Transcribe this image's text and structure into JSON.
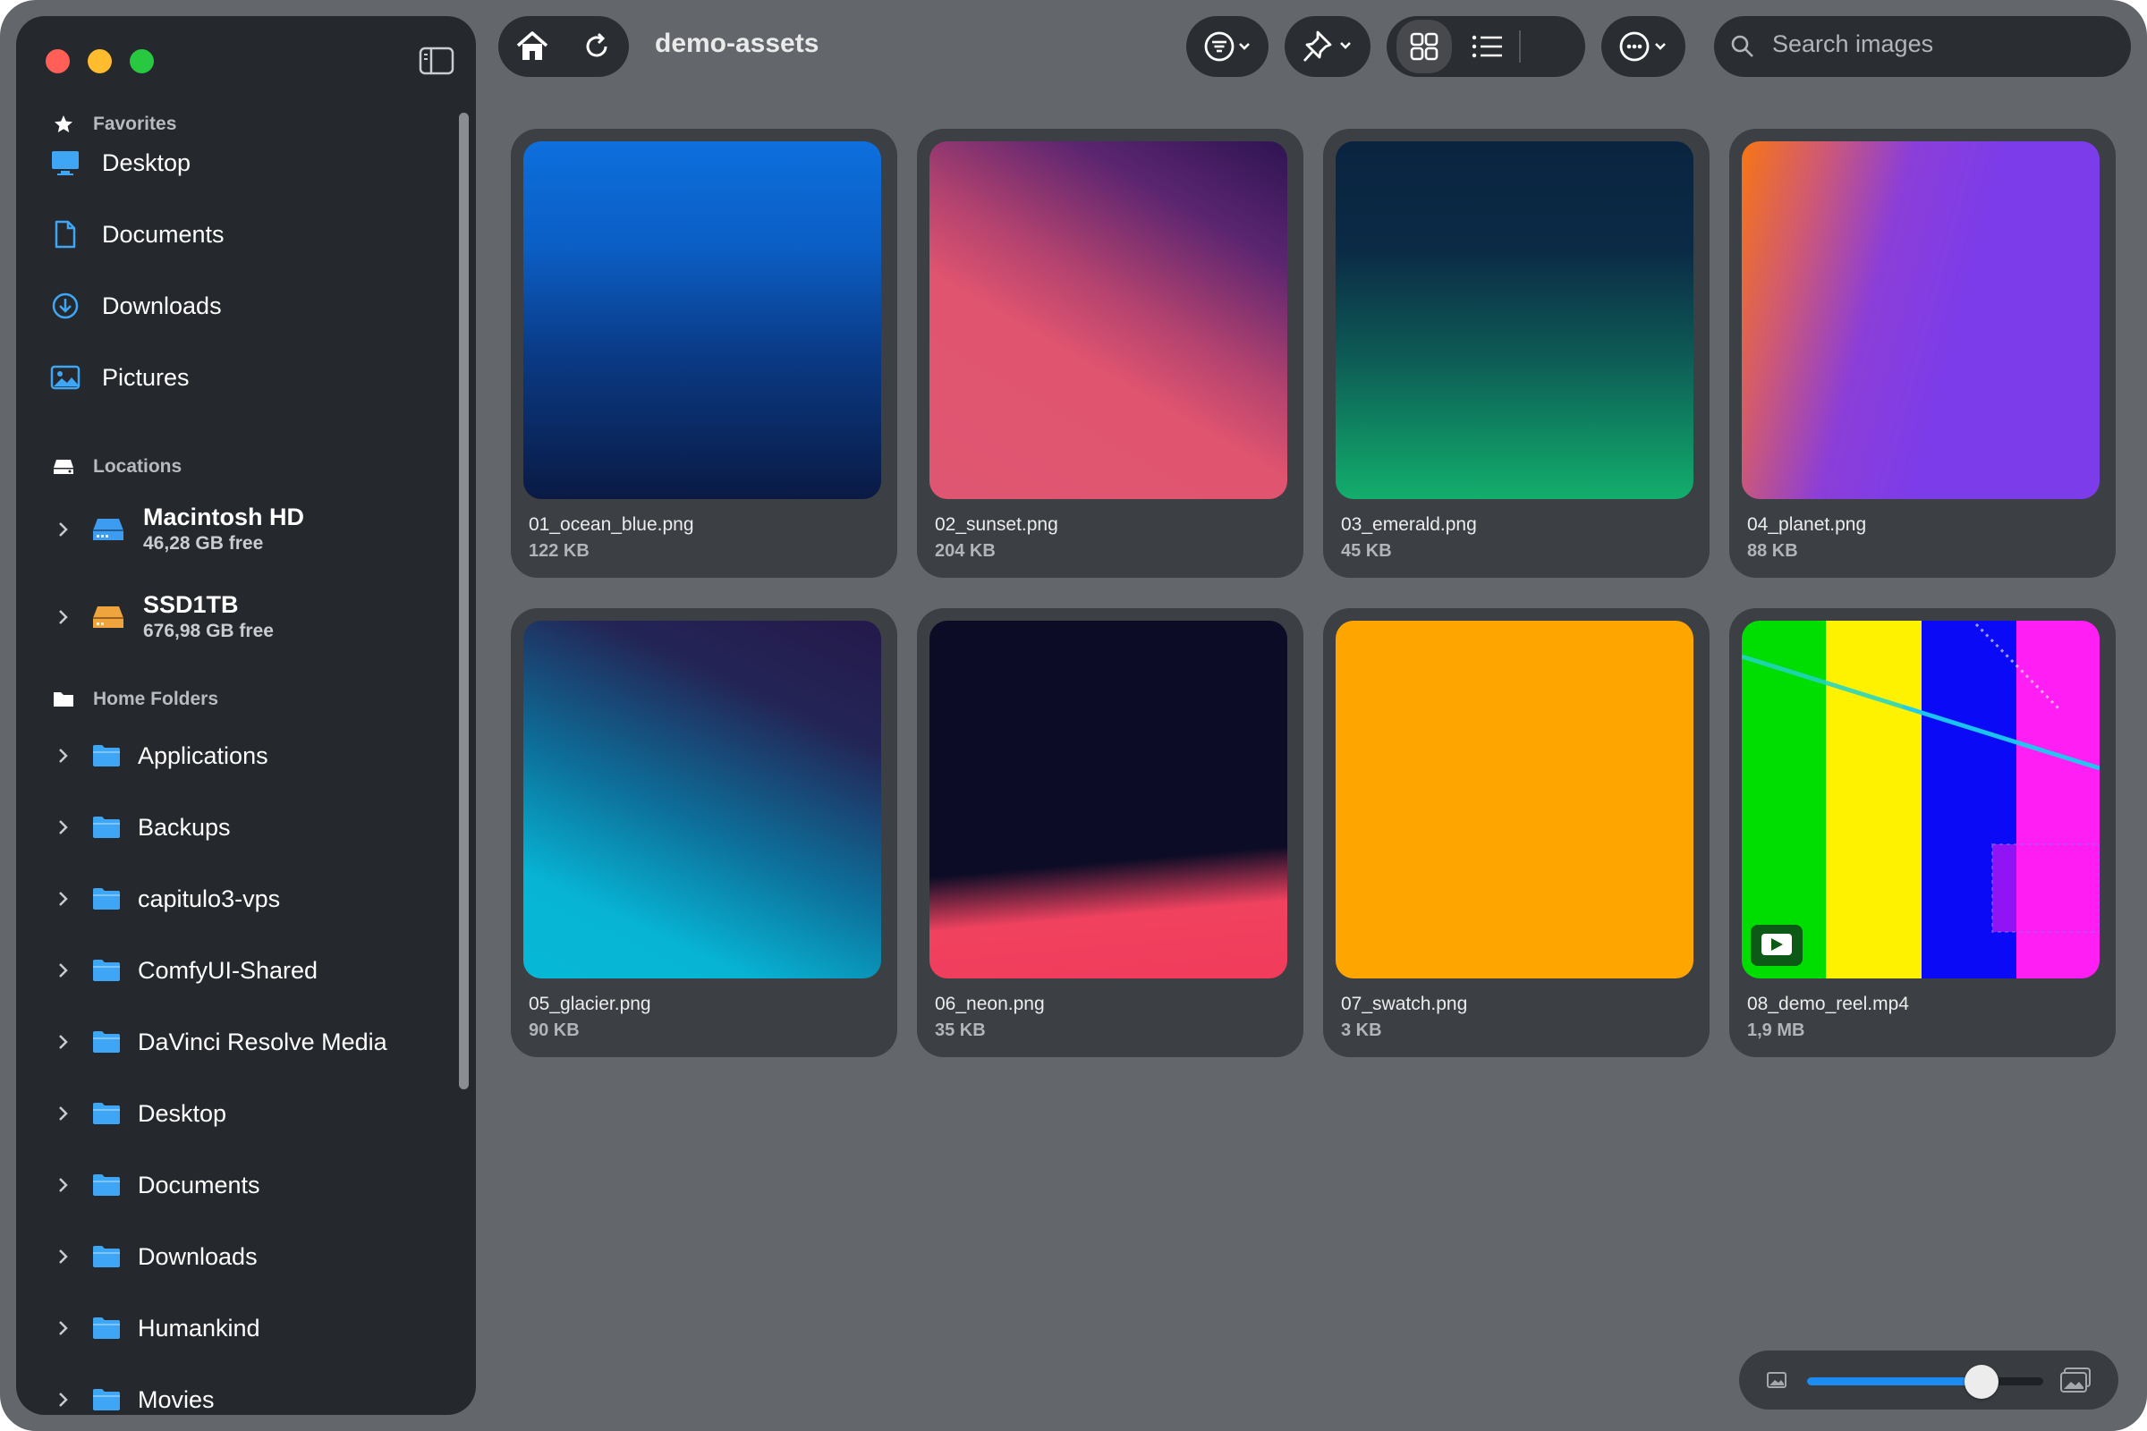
{
  "toolbar": {
    "folder_title": "demo-assets",
    "search_placeholder": "Search images",
    "icons": [
      "home-icon",
      "refresh-icon",
      "filter-icon",
      "pin-icon",
      "grid-view-icon",
      "list-view-icon",
      "more-icon",
      "search-icon"
    ]
  },
  "sidebar": {
    "favorites_header": "Favorites",
    "favorites": [
      {
        "label": "Desktop",
        "icon": "desktop-icon"
      },
      {
        "label": "Documents",
        "icon": "document-icon"
      },
      {
        "label": "Downloads",
        "icon": "download-icon"
      },
      {
        "label": "Pictures",
        "icon": "picture-icon"
      }
    ],
    "locations_header": "Locations",
    "locations": [
      {
        "name": "Macintosh HD",
        "free": "46,28 GB free",
        "color": "#3d9cf0"
      },
      {
        "name": "SSD1TB",
        "free": "676,98 GB free",
        "color": "#f0a43d"
      }
    ],
    "home_header": "Home Folders",
    "home_folders": [
      "Applications",
      "Backups",
      "capitulo3-vps",
      "ComfyUI-Shared",
      "DaVinci Resolve Media",
      "Desktop",
      "Documents",
      "Downloads",
      "Humankind",
      "Movies"
    ]
  },
  "files": [
    {
      "name": "01_ocean_blue.png",
      "size": "122 KB"
    },
    {
      "name": "02_sunset.png",
      "size": "204 KB"
    },
    {
      "name": "03_emerald.png",
      "size": "45 KB"
    },
    {
      "name": "04_planet.png",
      "size": "88 KB"
    },
    {
      "name": "05_glacier.png",
      "size": "90 KB"
    },
    {
      "name": "06_neon.png",
      "size": "35 KB"
    },
    {
      "name": "07_swatch.png",
      "size": "3 KB"
    },
    {
      "name": "08_demo_reel.mp4",
      "size": "1,9 MB"
    }
  ],
  "zoom": {
    "level": 0.74
  },
  "colors": {
    "accent": "#1d8cf2",
    "folder": "#3ea6f5",
    "sidebar": "#25282c"
  }
}
